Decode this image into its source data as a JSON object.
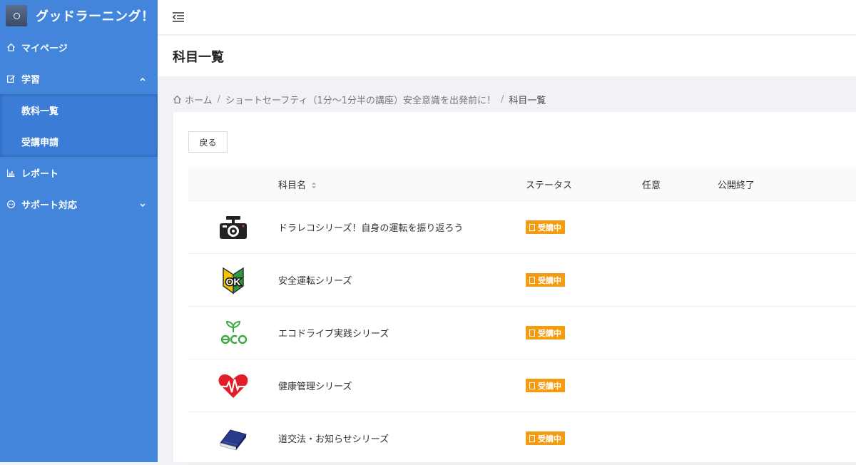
{
  "app": {
    "title": "グッドラーニング！"
  },
  "sidebar": {
    "items": [
      {
        "label": "マイページ"
      },
      {
        "label": "学習"
      },
      {
        "label": "教科一覧"
      },
      {
        "label": "受講申請"
      },
      {
        "label": "レポート"
      },
      {
        "label": "サポート対応"
      }
    ]
  },
  "page": {
    "title": "科目一覧"
  },
  "breadcrumb": {
    "home": "ホーム",
    "sep": "/",
    "course": "ショートセーフティ（1分〜1分半の講座）安全意識を出発前に！",
    "current": "科目一覧"
  },
  "actions": {
    "back": "戻る"
  },
  "table": {
    "headers": {
      "name": "科目名",
      "status": "ステータス",
      "optional": "任意",
      "end": "公開終了"
    },
    "rows": [
      {
        "icon": "dashcam-icon",
        "name": "ドラレコシリーズ！自身の運転を振り返ろう",
        "status": "受講中"
      },
      {
        "icon": "beginner-ok-icon",
        "name": "安全運転シリーズ",
        "status": "受講中"
      },
      {
        "icon": "eco-icon",
        "name": "エコドライブ実践シリーズ",
        "status": "受講中"
      },
      {
        "icon": "heart-pulse-icon",
        "name": "健康管理シリーズ",
        "status": "受講中"
      },
      {
        "icon": "book-icon",
        "name": "道交法・お知らせシリーズ",
        "status": "受講中"
      }
    ]
  },
  "colors": {
    "sidebar": "#4285db",
    "badge": "#f39c12"
  }
}
